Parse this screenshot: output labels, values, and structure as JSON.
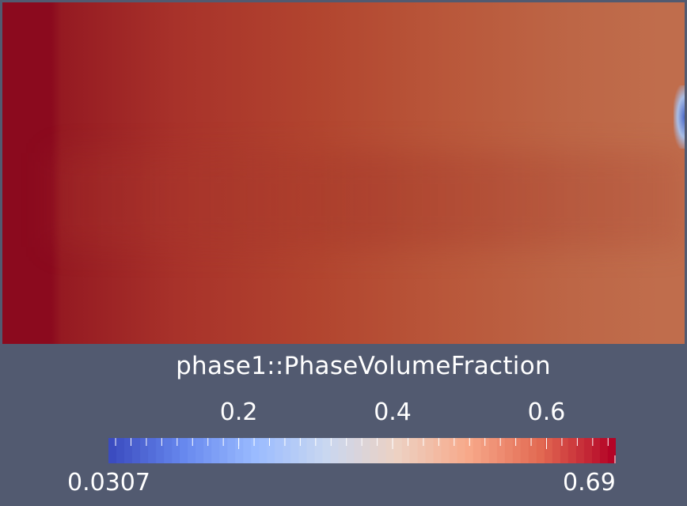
{
  "colorbar": {
    "title": "phase1::PhaseVolumeFraction",
    "min_label": "0.0307",
    "max_label": "0.69",
    "range": [
      0.0307,
      0.69
    ],
    "major_ticks": [
      {
        "value": 0.2,
        "label": "0.2"
      },
      {
        "value": 0.4,
        "label": "0.4"
      },
      {
        "value": 0.6,
        "label": "0.6"
      }
    ],
    "minor_tick_step": 0.02,
    "colors": [
      "#3b4cc0",
      "#6788ee",
      "#9abbff",
      "#c9d7f0",
      "#edd1c2",
      "#f7a889",
      "#e26952",
      "#b40426"
    ]
  },
  "colors": {
    "background": "#525a70",
    "field_low": "#8b0a1e",
    "field_high": "#c06d4c"
  }
}
